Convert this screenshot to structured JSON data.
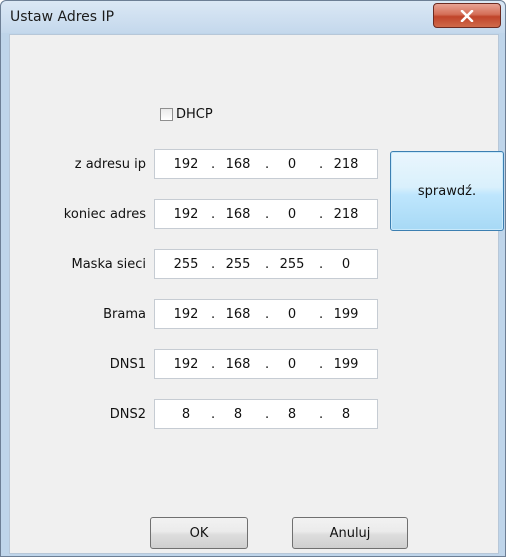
{
  "window": {
    "title": "Ustaw Adres IP",
    "close_icon": "close-x-icon",
    "close_color": "#c74a30"
  },
  "dhcp": {
    "label": "DHCP",
    "checked": false
  },
  "rows": [
    {
      "label": "z adresu ip",
      "octets": [
        "192",
        "168",
        "0",
        "218"
      ]
    },
    {
      "label": "koniec adres",
      "octets": [
        "192",
        "168",
        "0",
        "218"
      ]
    },
    {
      "label": "Maska sieci",
      "octets": [
        "255",
        "255",
        "255",
        "0"
      ]
    },
    {
      "label": "Brama",
      "octets": [
        "192",
        "168",
        "0",
        "199"
      ]
    },
    {
      "label": "DNS1",
      "octets": [
        "192",
        "168",
        "0",
        "199"
      ]
    },
    {
      "label": "DNS2",
      "octets": [
        "8",
        "8",
        "8",
        "8"
      ]
    }
  ],
  "buttons": {
    "check": "sprawdź.",
    "ok": "OK",
    "cancel": "Anuluj"
  },
  "colors": {
    "titlebar": "#c4d8ec",
    "client": "#f0f0f0",
    "check_button": "#bee6fd"
  }
}
